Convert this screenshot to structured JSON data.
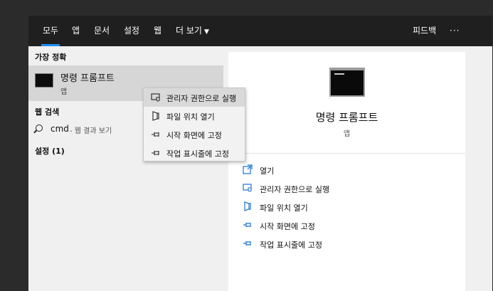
{
  "tabs": [
    {
      "label": "모두"
    },
    {
      "label": "앱"
    },
    {
      "label": "문서"
    },
    {
      "label": "설정"
    },
    {
      "label": "웹"
    },
    {
      "label": "더 보기"
    }
  ],
  "header": {
    "feedback_label": "피드백",
    "more_label": "···"
  },
  "left": {
    "best_match_title": "가장 정확",
    "best_match": {
      "name": "명령 프롬프트",
      "type": "앱"
    },
    "web_search_title": "웹 검색",
    "web_search": {
      "query": "cmd",
      "suffix": "- 웹 결과 보기"
    },
    "settings_title": "설정 (1)"
  },
  "context_menu": {
    "items": [
      {
        "label": "관리자 권한으로 실행",
        "icon": "shield-run-icon"
      },
      {
        "label": "파일 위치 열기",
        "icon": "folder-location-icon"
      },
      {
        "label": "시작 화면에 고정",
        "icon": "pin-icon"
      },
      {
        "label": "작업 표시줄에 고정",
        "icon": "pin-icon"
      }
    ]
  },
  "preview": {
    "name": "명령 프롬프트",
    "type": "앱",
    "actions": [
      {
        "label": "열기",
        "icon": "open-icon"
      },
      {
        "label": "관리자 권한으로 실행",
        "icon": "shield-run-icon"
      },
      {
        "label": "파일 위치 열기",
        "icon": "folder-location-icon"
      },
      {
        "label": "시작 화면에 고정",
        "icon": "pin-icon"
      },
      {
        "label": "작업 표시줄에 고정",
        "icon": "pin-icon"
      }
    ]
  },
  "colors": {
    "accent": "#1e90ff",
    "topbar": "#1f1f1f",
    "icon_blue": "#1a73d9"
  }
}
